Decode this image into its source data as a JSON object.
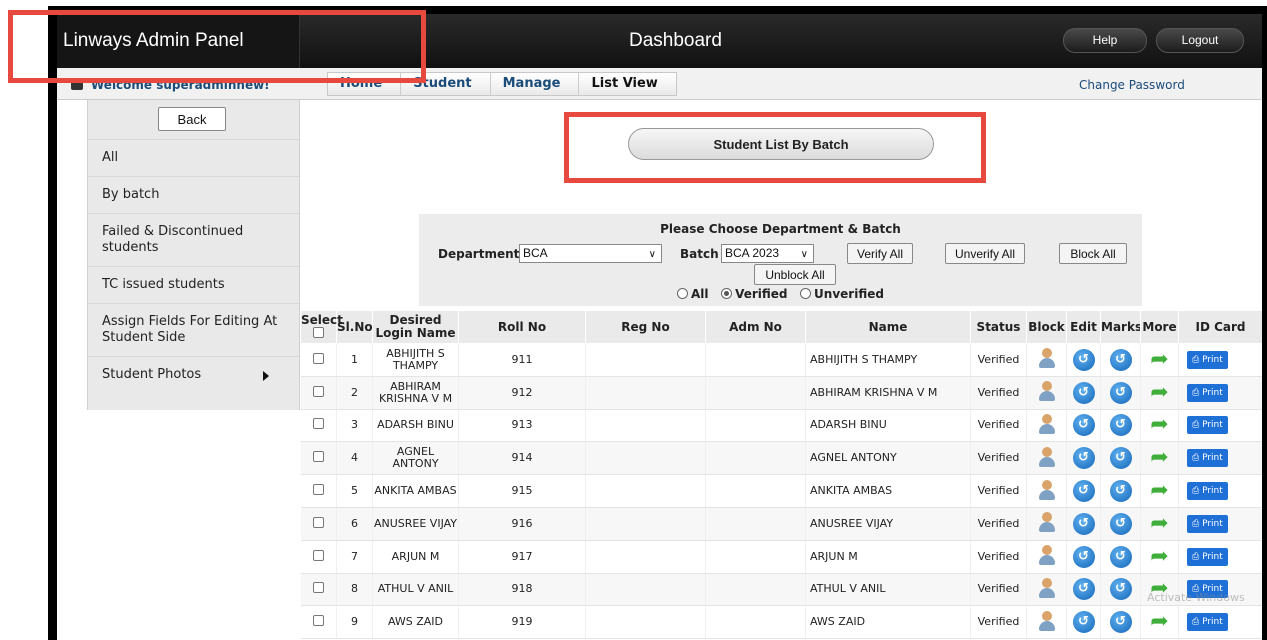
{
  "header": {
    "brand": "Linways Admin Panel",
    "title": "Dashboard",
    "help_label": "Help",
    "logout_label": "Logout"
  },
  "subbar": {
    "welcome": "Welcome superadminnew!",
    "breadcrumbs": [
      "Home",
      "Student",
      "Manage",
      "List View"
    ],
    "change_password": "Change Password"
  },
  "sidebar": {
    "back_label": "Back",
    "items": [
      {
        "label": "All"
      },
      {
        "label": "By batch"
      },
      {
        "label": "Failed & Discontinued students"
      },
      {
        "label": "TC issued students"
      },
      {
        "label": "Assign Fields For Editing At Student Side"
      },
      {
        "label": "Student Photos"
      }
    ]
  },
  "main": {
    "list_button": "Student List By Batch"
  },
  "filter": {
    "title": "Please Choose Department & Batch",
    "department_label": "Department",
    "department_value": "BCA",
    "batch_label": "Batch",
    "batch_value": "BCA 2023",
    "verify_all": "Verify All",
    "unverify_all": "Unverify All",
    "block_all": "Block All",
    "unblock_all": "Unblock All",
    "radio_all": "All",
    "radio_verified": "Verified",
    "radio_unverified": "Unverified",
    "selected_radio": "Verified"
  },
  "table": {
    "headers": {
      "select": "Select",
      "slno": "Sl.No",
      "login": "Desired Login Name",
      "roll": "Roll No",
      "reg": "Reg No",
      "adm": "Adm No",
      "name": "Name",
      "status": "Status",
      "block": "Block",
      "edit": "Edit",
      "marks": "Marks",
      "more": "More",
      "id_card": "ID Card"
    },
    "print_label": "Print",
    "rows": [
      {
        "sl": "1",
        "login": "ABHIJITH S THAMPY",
        "roll": "911",
        "reg": "",
        "adm": "",
        "name": "ABHIJITH S THAMPY",
        "status": "Verified"
      },
      {
        "sl": "2",
        "login": "ABHIRAM KRISHNA V M",
        "roll": "912",
        "reg": "",
        "adm": "",
        "name": "ABHIRAM KRISHNA V M",
        "status": "Verified"
      },
      {
        "sl": "3",
        "login": "ADARSH BINU",
        "roll": "913",
        "reg": "",
        "adm": "",
        "name": "ADARSH BINU",
        "status": "Verified"
      },
      {
        "sl": "4",
        "login": "AGNEL ANTONY",
        "roll": "914",
        "reg": "",
        "adm": "",
        "name": "AGNEL ANTONY",
        "status": "Verified"
      },
      {
        "sl": "5",
        "login": "ANKITA AMBAS",
        "roll": "915",
        "reg": "",
        "adm": "",
        "name": "ANKITA AMBAS",
        "status": "Verified"
      },
      {
        "sl": "6",
        "login": "ANUSREE VIJAY",
        "roll": "916",
        "reg": "",
        "adm": "",
        "name": "ANUSREE VIJAY",
        "status": "Verified"
      },
      {
        "sl": "7",
        "login": "ARJUN M",
        "roll": "917",
        "reg": "",
        "adm": "",
        "name": "ARJUN M",
        "status": "Verified"
      },
      {
        "sl": "8",
        "login": "ATHUL V ANIL",
        "roll": "918",
        "reg": "",
        "adm": "",
        "name": "ATHUL V ANIL",
        "status": "Verified"
      },
      {
        "sl": "9",
        "login": "AWS ZAID",
        "roll": "919",
        "reg": "",
        "adm": "",
        "name": "AWS ZAID",
        "status": "Verified"
      }
    ]
  },
  "colors": {
    "highlight": "#e8493f",
    "link": "#1a4c7a",
    "verified": "#1d7a1d",
    "print_button": "#1e6fd6"
  }
}
